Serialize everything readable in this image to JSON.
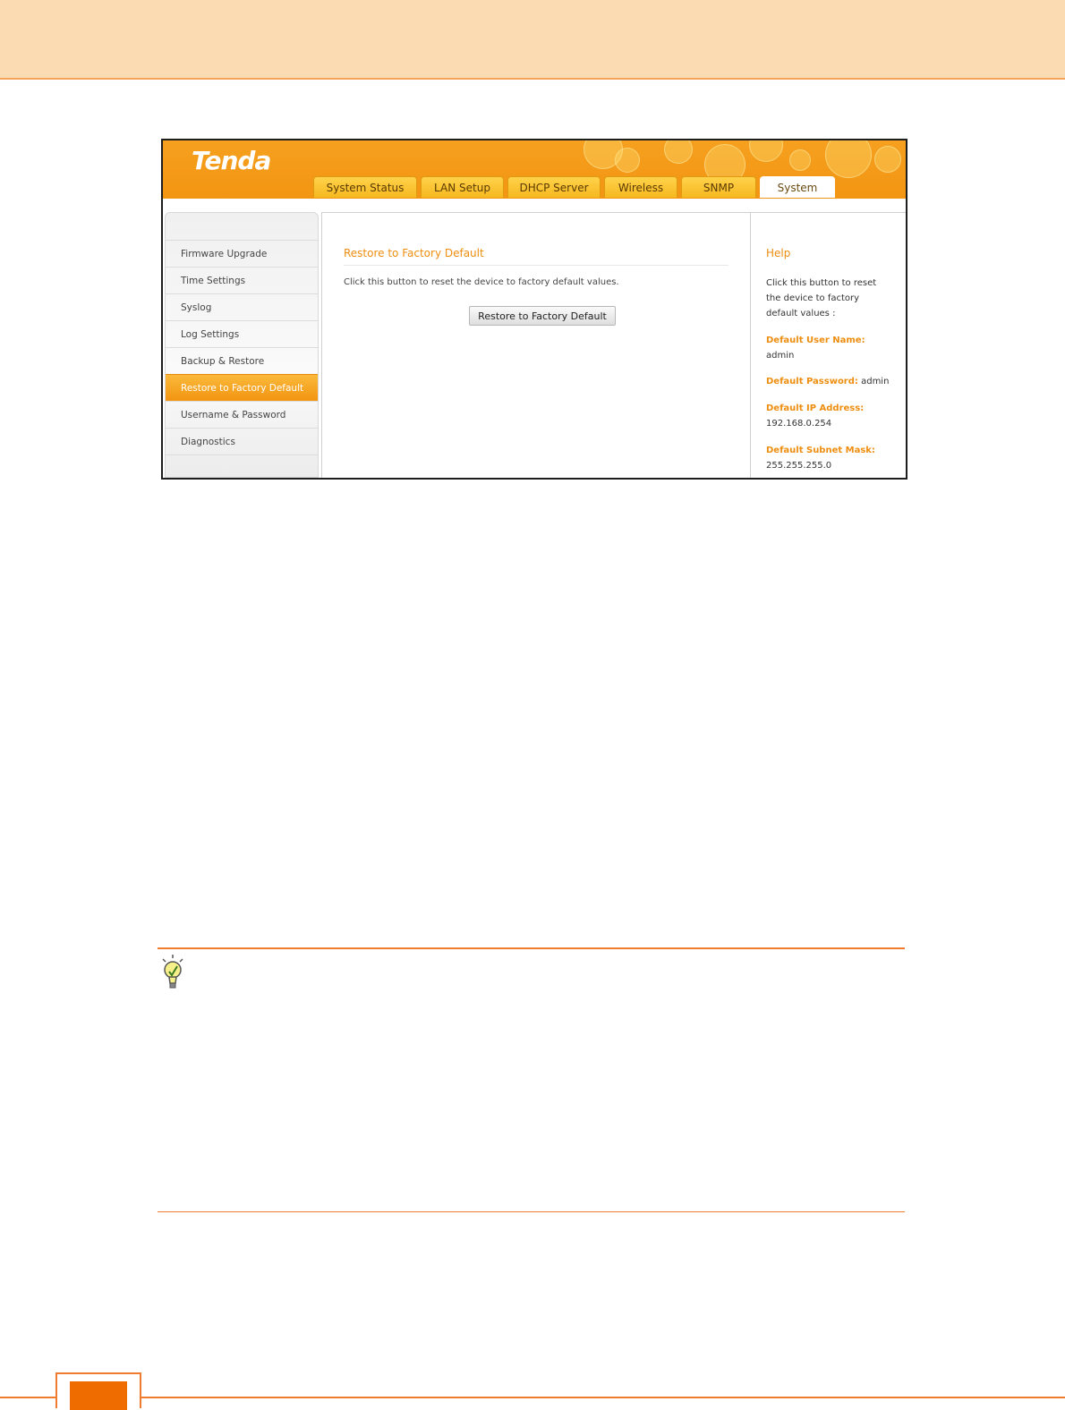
{
  "router": {
    "logo": "Tenda",
    "tabs": [
      "System Status",
      "LAN Setup",
      "DHCP Server",
      "Wireless",
      "SNMP",
      "System"
    ],
    "active_tab": "System",
    "sidebar": [
      {
        "label": "Firmware Upgrade"
      },
      {
        "label": "Time Settings"
      },
      {
        "label": "Syslog"
      },
      {
        "label": "Log Settings"
      },
      {
        "label": "Backup & Restore"
      },
      {
        "label": "Restore to Factory Default",
        "active": true
      },
      {
        "label": "Username & Password"
      },
      {
        "label": "Diagnostics"
      }
    ],
    "content": {
      "title": "Restore to Factory Default",
      "description": "Click this button to reset the device to factory default values.",
      "button_label": "Restore to Factory Default"
    },
    "help": {
      "title": "Help",
      "intro": "Click this button to reset the device to factory default values :",
      "user_name_label": "Default User Name:",
      "user_name_value": "admin",
      "password_label": "Default Password:",
      "password_value": "admin",
      "ip_label": "Default IP Address:",
      "ip_value": "192.168.0.254",
      "mask_label": "Default Subnet Mask:",
      "mask_value": "255.255.255.0"
    }
  },
  "colors": {
    "accent": "#f29512",
    "header_bg": "#fbdbb2",
    "rule": "#f07c30",
    "page_tab": "#ef6c00"
  },
  "icons": [
    "lightbulb-tip-icon"
  ]
}
